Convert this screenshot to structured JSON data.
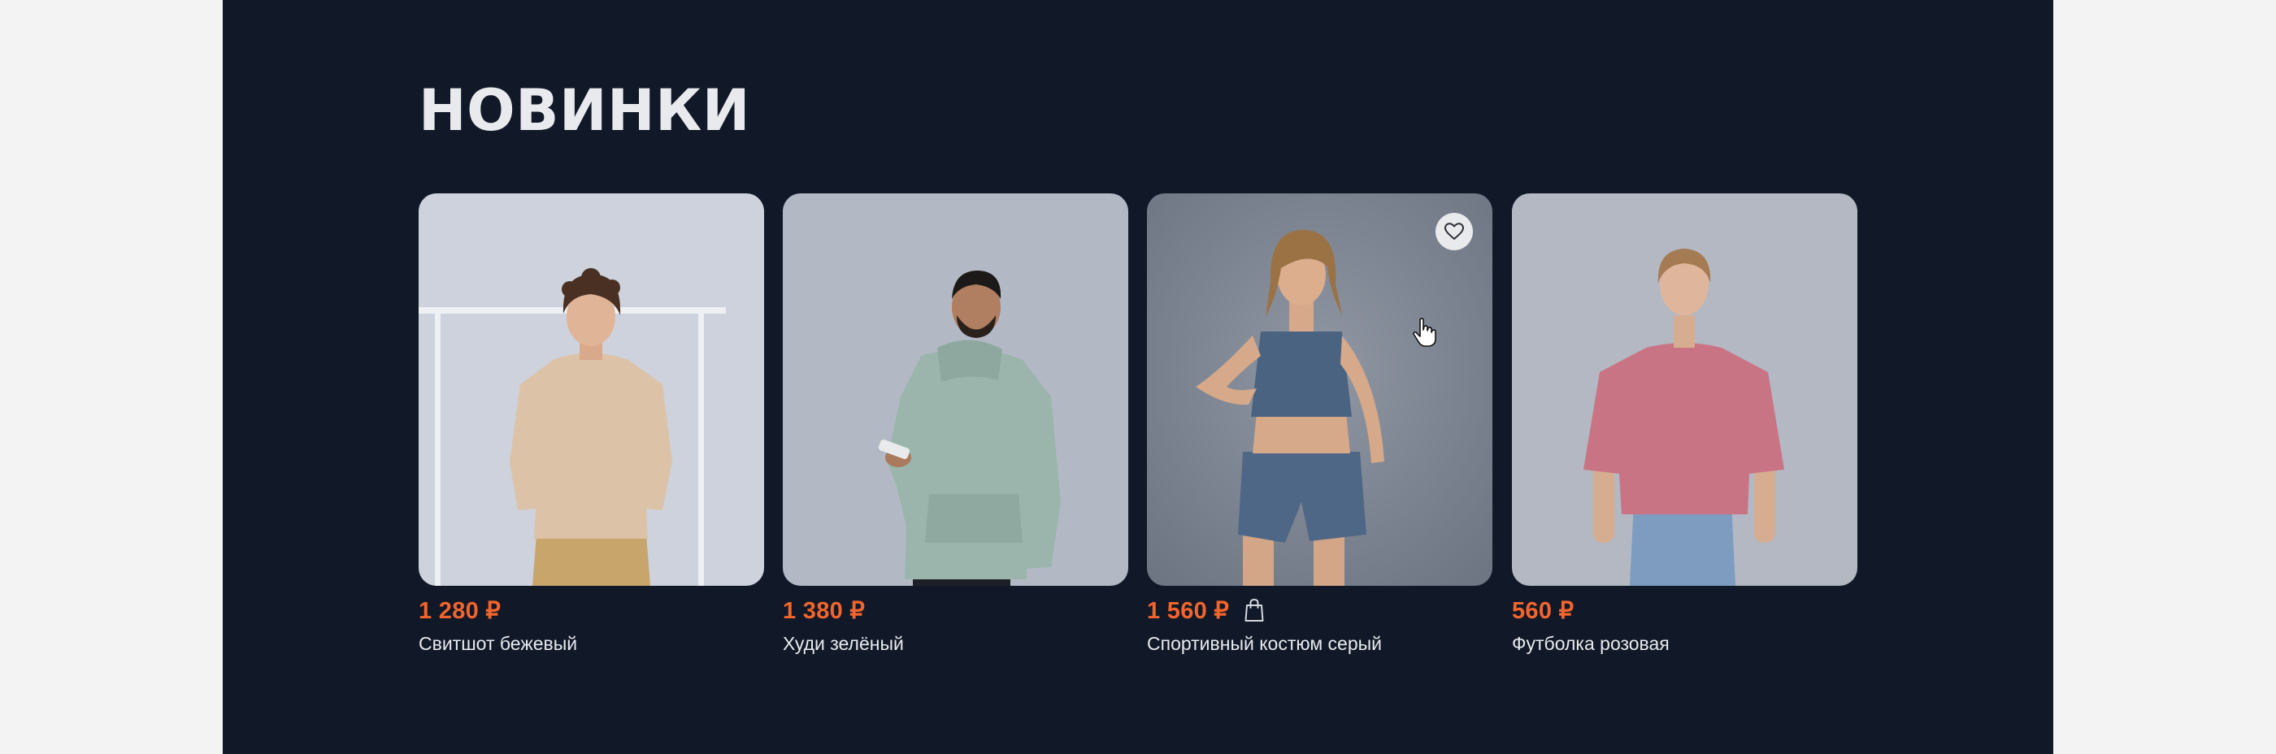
{
  "section": {
    "title": "НОВИНКИ"
  },
  "products": [
    {
      "price": "1 280 ₽",
      "name": "Свитшот бежевый",
      "image_icon": "person-beige-sweatshirt"
    },
    {
      "price": "1 380 ₽",
      "name": "Худи зелёный",
      "image_icon": "person-green-hoodie"
    },
    {
      "price": "1 560 ₽",
      "name": "Спортивный костюм серый",
      "image_icon": "person-sport-suit",
      "favorite_icon": "heart-icon",
      "cart_icon": "shopping-bag-icon"
    },
    {
      "price": "560 ₽",
      "name": "Футболка розовая",
      "image_icon": "person-pink-tshirt"
    }
  ],
  "colors": {
    "background": "#111827",
    "accent_price": "#f2652c",
    "text": "#e8eaee"
  }
}
